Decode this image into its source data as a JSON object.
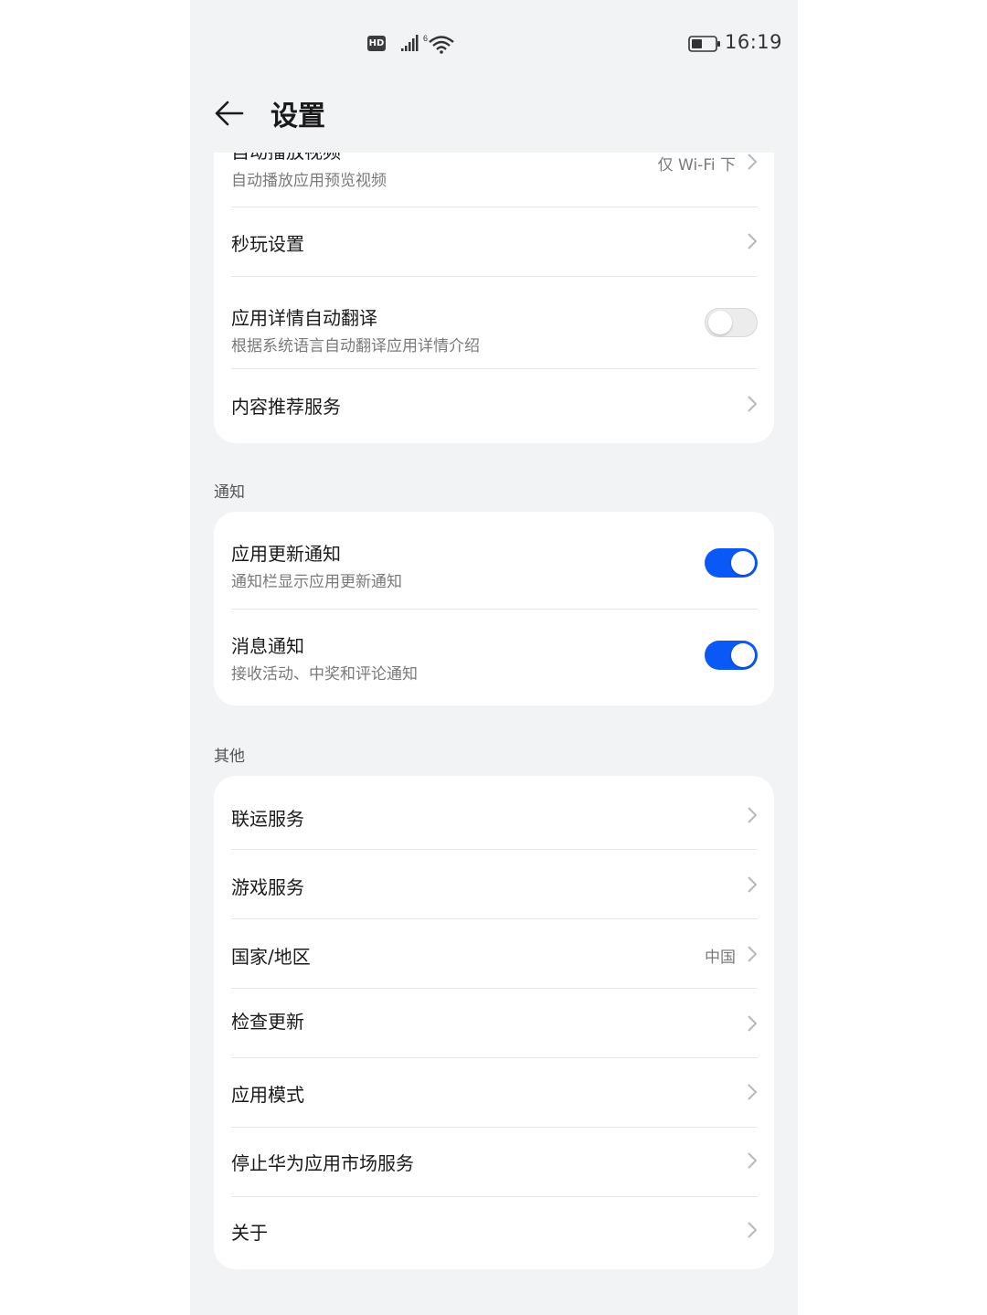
{
  "status_bar": {
    "hd": "HD",
    "signal": "4G",
    "time": "16:19"
  },
  "header": {
    "title": "设置"
  },
  "section1": {
    "items": [
      {
        "title": "自动播放视频",
        "subtitle": "自动播放应用预览视频",
        "value": "仅 Wi-Fi 下"
      },
      {
        "title": "秒玩设置"
      },
      {
        "title": "应用详情自动翻译",
        "subtitle": "根据系统语言自动翻译应用详情介绍",
        "toggle": "off"
      },
      {
        "title": "内容推荐服务"
      }
    ]
  },
  "notify": {
    "label": "通知",
    "items": [
      {
        "title": "应用更新通知",
        "subtitle": "通知栏显示应用更新通知",
        "toggle": "on"
      },
      {
        "title": "消息通知",
        "subtitle": "接收活动、中奖和评论通知",
        "toggle": "on"
      }
    ]
  },
  "other": {
    "label": "其他",
    "items": [
      {
        "title": "联运服务"
      },
      {
        "title": "游戏服务"
      },
      {
        "title": "国家/地区",
        "value": "中国"
      },
      {
        "title": "检查更新"
      },
      {
        "title": "应用模式"
      },
      {
        "title": "停止华为应用市场服务"
      },
      {
        "title": "关于"
      }
    ]
  },
  "colors": {
    "accent": "#0a59f7",
    "background": "#f1f3f5"
  }
}
